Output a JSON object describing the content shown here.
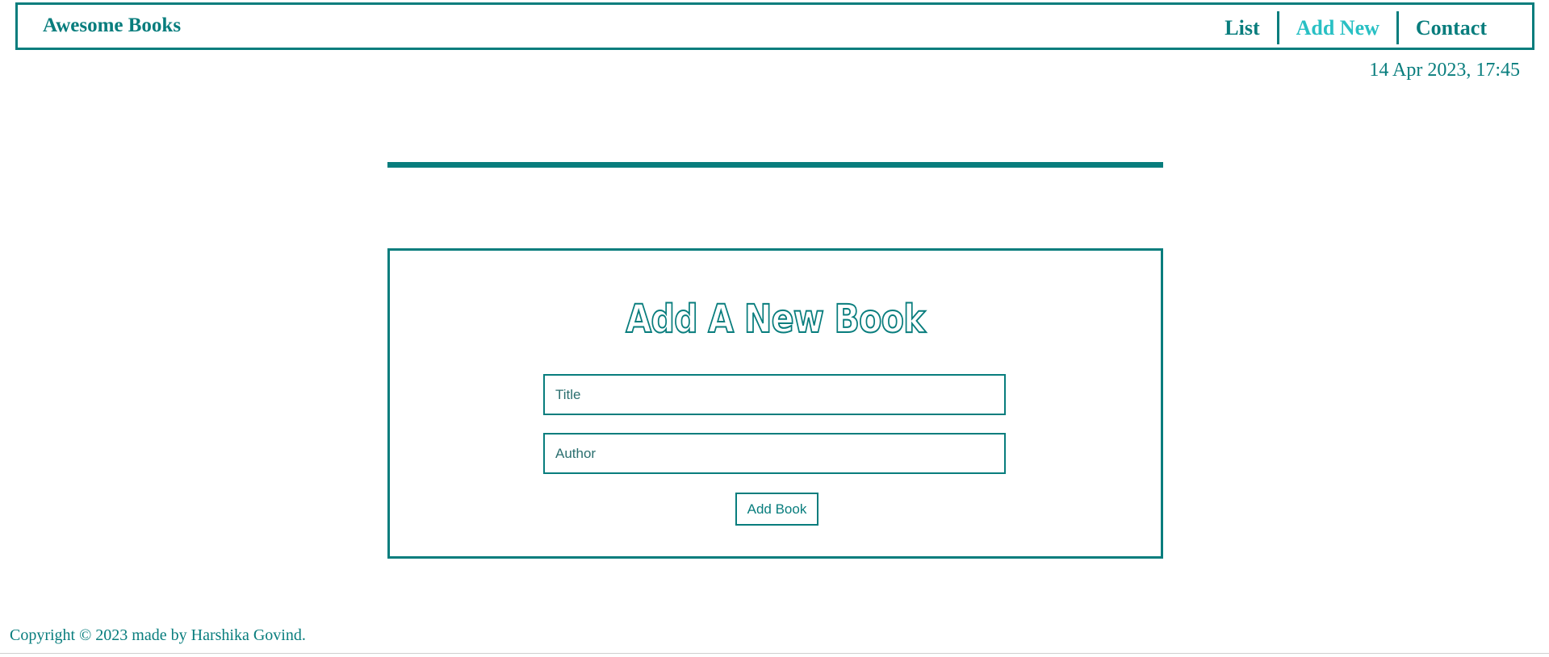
{
  "header": {
    "logo": "Awesome Books",
    "nav": [
      {
        "label": "List",
        "active": false
      },
      {
        "label": "Add New",
        "active": true
      },
      {
        "label": "Contact",
        "active": false
      }
    ]
  },
  "datetime": "14 Apr 2023, 17:45",
  "form": {
    "heading": "Add A New Book",
    "title_placeholder": "Title",
    "author_placeholder": "Author",
    "title_value": "",
    "author_value": "",
    "submit_label": "Add Book"
  },
  "footer": {
    "copyright": "Copyright © 2023 made by Harshika Govind."
  },
  "colors": {
    "primary": "#087d7d",
    "active_link": "#29c0c4",
    "background": "#ffffff"
  }
}
